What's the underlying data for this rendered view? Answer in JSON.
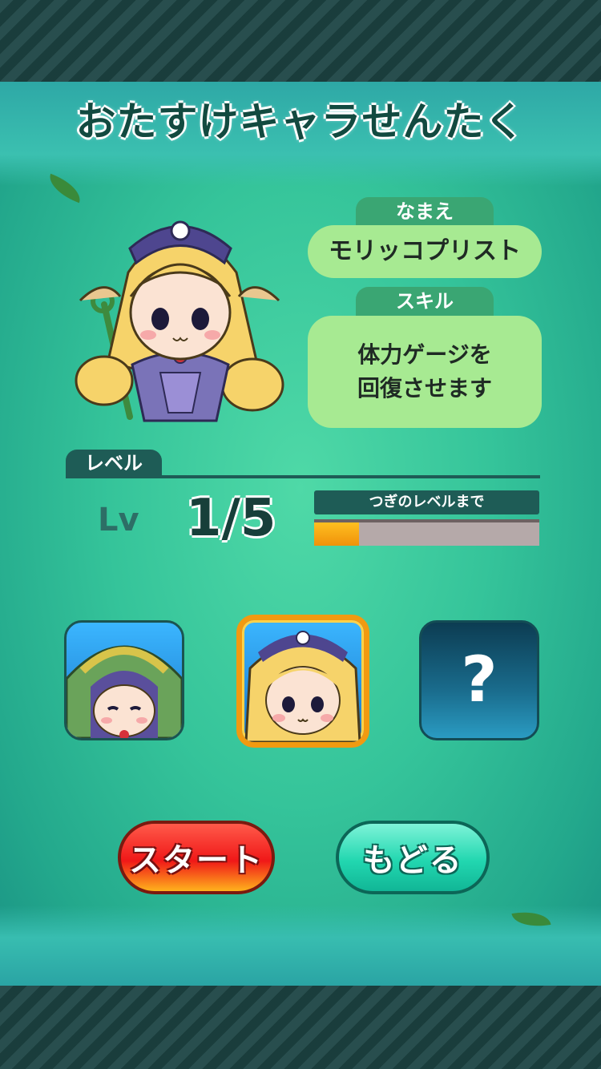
{
  "screen": {
    "title": "おたすけキャラせんたく"
  },
  "character": {
    "name_label": "なまえ",
    "name": "モリッコプリスト",
    "skill_label": "スキル",
    "skill": "体力ゲージを\n回復させます"
  },
  "level": {
    "section_label": "レベル",
    "prefix": "Lv",
    "value": "1/5",
    "next_label": "つぎのレベルまで",
    "progress": 0.2
  },
  "icons": [
    {
      "name": "hooded-character-icon",
      "selected": false,
      "locked": false
    },
    {
      "name": "priest-character-icon",
      "selected": true,
      "locked": false
    },
    {
      "name": "locked-character-icon",
      "selected": false,
      "locked": true,
      "symbol": "?"
    }
  ],
  "buttons": {
    "start": "スタート",
    "back": "もどる"
  },
  "colors": {
    "panel": "#35c49a",
    "pill": "#a7ea92",
    "tag": "#3aa673",
    "progress_fill": "#f0920a",
    "selected_border": "#f19a11"
  }
}
